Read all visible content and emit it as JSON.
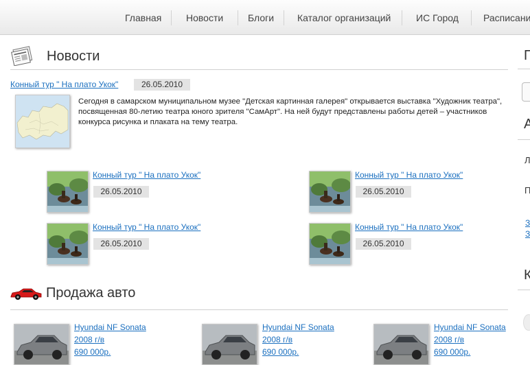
{
  "nav": {
    "items": [
      "Главная",
      "Новости",
      "Блоги",
      "Каталог организаций",
      "ИС Город",
      "Расписание"
    ]
  },
  "news": {
    "title": "Новости",
    "main": {
      "link": "Конный тур \" На плато Укок\"",
      "date": "26.05.2010",
      "text": "Сегодня в самарском муниципальном музее \"Детская картинная галерея\" открывается выставка \"Художник театра\", посвященная 80-летию театра юного зрителя \"СамАрт\". На ней будут представлены работы детей – участников конкурса рисунка и плаката на тему театра."
    },
    "items": [
      {
        "link": "Конный тур \" На плато Укок\"",
        "date": "26.05.2010"
      },
      {
        "link": "Конный тур \" На плато Укок\"",
        "date": "26.05.2010"
      },
      {
        "link": "Конный тур \" На плато Укок\"",
        "date": "26.05.2010"
      },
      {
        "link": "Конный тур \" На плато Укок\"",
        "date": "26.05.2010"
      }
    ]
  },
  "autos": {
    "title": "Продажа авто",
    "items": [
      {
        "name": "Hyundai NF Sonata",
        "year": "2008 г/в",
        "price": "690 000р."
      },
      {
        "name": "Hyundai NF Sonata",
        "year": "2008 г/в",
        "price": "690 000р."
      },
      {
        "name": "Hyundai NF Sonata",
        "year": "2008 г/в",
        "price": "690 000р."
      }
    ]
  },
  "right_column": {
    "h1": "П",
    "h2": "А",
    "t1": "Л",
    "t2": "П",
    "l1": "З",
    "l2": "З",
    "h3": "К"
  },
  "colors": {
    "link": "#1a6fbf",
    "date_bg": "#e3e3e3"
  }
}
